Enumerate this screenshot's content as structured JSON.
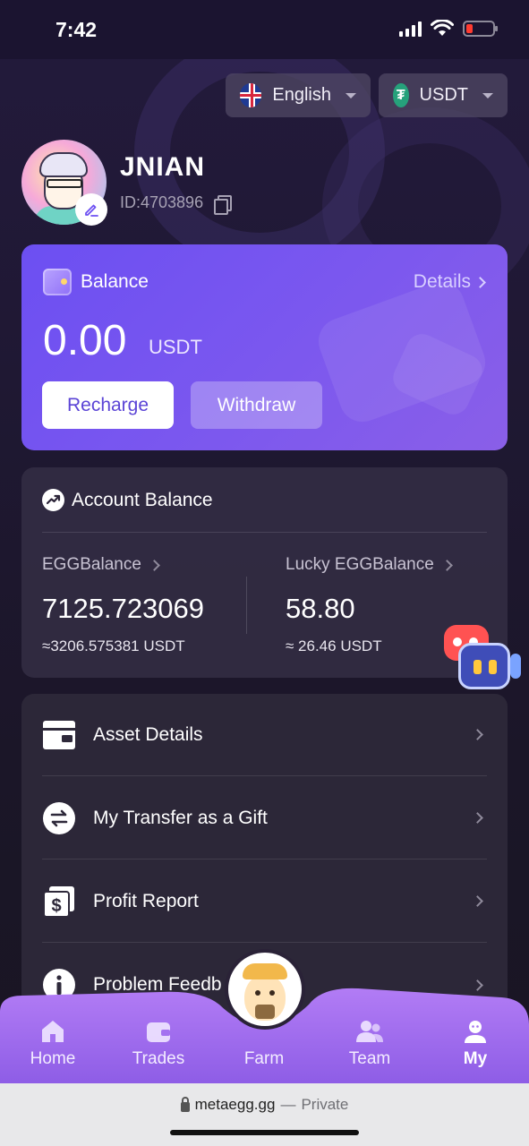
{
  "status_bar": {
    "time": "7:42"
  },
  "language_selector": {
    "label": "English",
    "icon": "uk-flag-icon"
  },
  "currency_selector": {
    "label": "USDT",
    "icon": "tether-icon"
  },
  "profile": {
    "username": "JNIAN",
    "user_id": "ID:4703896"
  },
  "balance_card": {
    "title": "Balance",
    "details_label": "Details",
    "amount": "0.00",
    "unit": "USDT",
    "recharge_label": "Recharge",
    "withdraw_label": "Withdraw",
    "accent": "#6c4ff2"
  },
  "account_balance": {
    "title": "Account Balance",
    "egg": {
      "label": "EGGBalance",
      "value": "7125.723069",
      "usdt": "≈3206.575381 USDT"
    },
    "lucky": {
      "label": "Lucky EGGBalance",
      "value": "58.80",
      "usdt": "≈ 26.46 USDT"
    }
  },
  "menu": {
    "items": [
      {
        "label": "Asset Details",
        "icon": "asset-card-icon"
      },
      {
        "label": "My Transfer as a Gift",
        "icon": "transfer-icon"
      },
      {
        "label": "Profit Report",
        "icon": "profit-report-icon"
      },
      {
        "label": "Problem Feedb",
        "icon": "info-icon"
      }
    ]
  },
  "bottom_nav": {
    "items": [
      {
        "label": "Home",
        "icon": "home-icon"
      },
      {
        "label": "Trades",
        "icon": "wallet-icon"
      },
      {
        "label": "Farm",
        "icon": "chick-mascot-icon"
      },
      {
        "label": "Team",
        "icon": "team-icon"
      },
      {
        "label": "My",
        "icon": "user-icon",
        "active": true
      }
    ],
    "color": "#9c6cf0"
  },
  "browser": {
    "domain": "metaegg.gg",
    "separator": "—",
    "mode": "Private"
  }
}
